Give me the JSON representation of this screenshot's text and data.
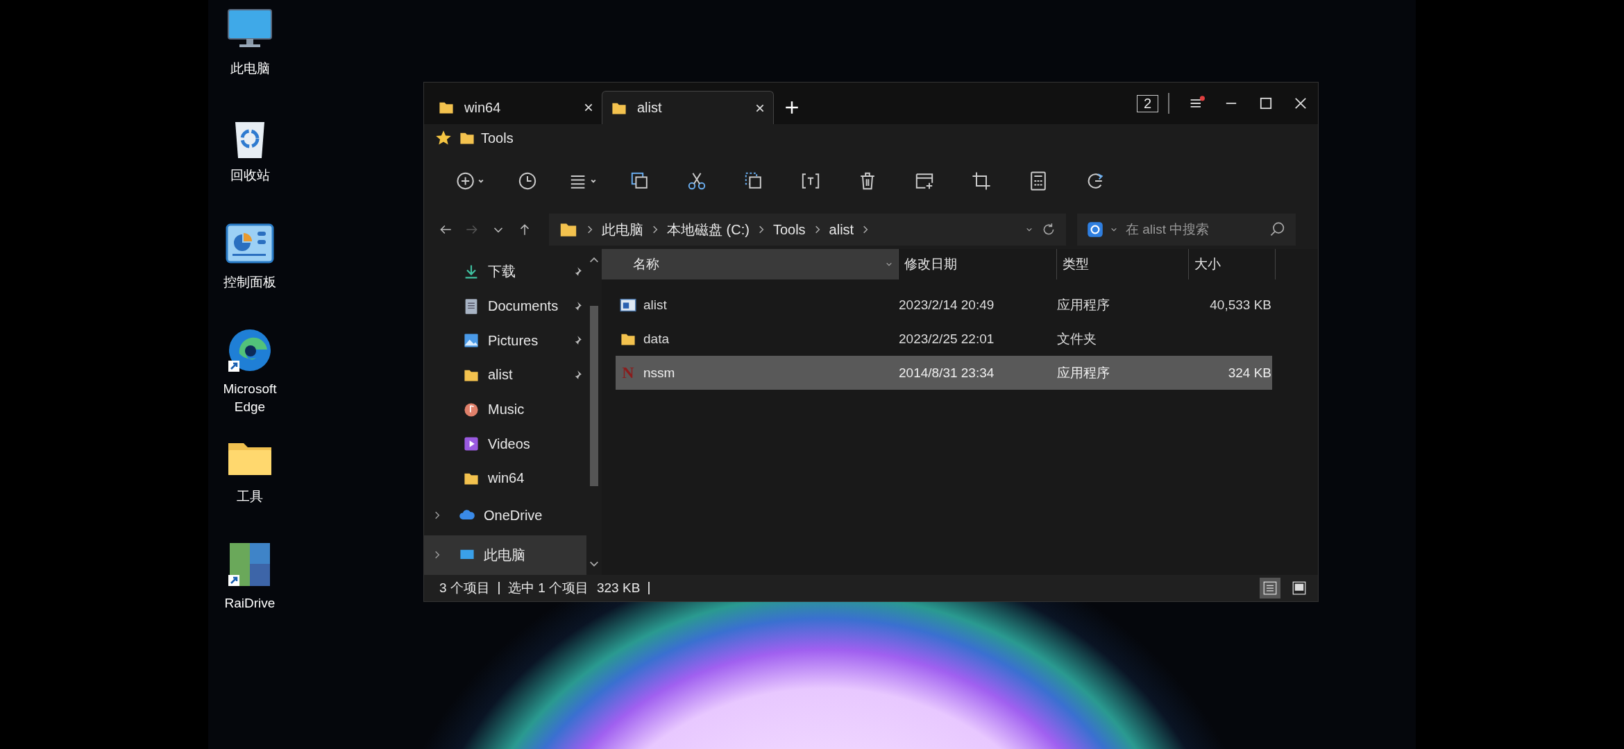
{
  "desktop_icons": [
    {
      "kind": "monitor",
      "label": "此电脑",
      "shortcut": false
    },
    {
      "kind": "recycle-bin",
      "label": "回收站",
      "shortcut": false
    },
    {
      "kind": "control-panel",
      "label": "控制面板",
      "shortcut": false
    },
    {
      "kind": "edge",
      "label": "Microsoft Edge",
      "shortcut": true
    },
    {
      "kind": "folder",
      "label": "工具",
      "shortcut": false
    },
    {
      "kind": "tiles",
      "label": "RaiDrive",
      "shortcut": true
    }
  ],
  "window": {
    "tabs": [
      {
        "label": "win64",
        "selected": false
      },
      {
        "label": "alist",
        "selected": true
      }
    ],
    "tab_count": "2",
    "favorites": [
      {
        "label": "Tools"
      }
    ],
    "address": {
      "crumbs": [
        "此电脑",
        "本地磁盘 (C:)",
        "Tools",
        "alist"
      ]
    },
    "search": {
      "placeholder": "在 alist 中搜索"
    },
    "sidebar": {
      "items": [
        {
          "kind": "download",
          "label": "下载",
          "pinned": true,
          "expander": false,
          "selected": false
        },
        {
          "kind": "documents",
          "label": "Documents",
          "pinned": true,
          "expander": false,
          "selected": false
        },
        {
          "kind": "pictures",
          "label": "Pictures",
          "pinned": true,
          "expander": false,
          "selected": false
        },
        {
          "kind": "folder",
          "label": "alist",
          "pinned": true,
          "expander": false,
          "selected": false
        },
        {
          "kind": "music",
          "label": "Music",
          "pinned": false,
          "expander": false,
          "selected": false
        },
        {
          "kind": "videos",
          "label": "Videos",
          "pinned": false,
          "expander": false,
          "selected": false
        },
        {
          "kind": "folder",
          "label": "win64",
          "pinned": false,
          "expander": false,
          "selected": false
        },
        {
          "kind": "cloud",
          "label": "OneDrive",
          "pinned": false,
          "expander": true,
          "selected": false
        },
        {
          "kind": "pc",
          "label": "此电脑",
          "pinned": false,
          "expander": true,
          "selected": true
        }
      ]
    },
    "table": {
      "columns": [
        "名称",
        "修改日期",
        "类型",
        "大小"
      ],
      "rows": [
        {
          "kind": "app",
          "name": "alist",
          "date": "2023/2/14 20:49",
          "type": "应用程序",
          "size": "40,533 KB",
          "selected": false
        },
        {
          "kind": "folder",
          "name": "data",
          "date": "2023/2/25 22:01",
          "type": "文件夹",
          "size": "",
          "selected": false
        },
        {
          "kind": "letter-app",
          "glyph": "N",
          "name": "nssm",
          "date": "2014/8/31 23:34",
          "type": "应用程序",
          "size": "324 KB",
          "selected": true
        }
      ]
    },
    "status_bar": {
      "items": [
        "3 个项目",
        "选中 1 个项目",
        "323 KB"
      ],
      "views": [
        {
          "kind": "details",
          "selected": true
        },
        {
          "kind": "tiles",
          "selected": false
        }
      ]
    }
  }
}
